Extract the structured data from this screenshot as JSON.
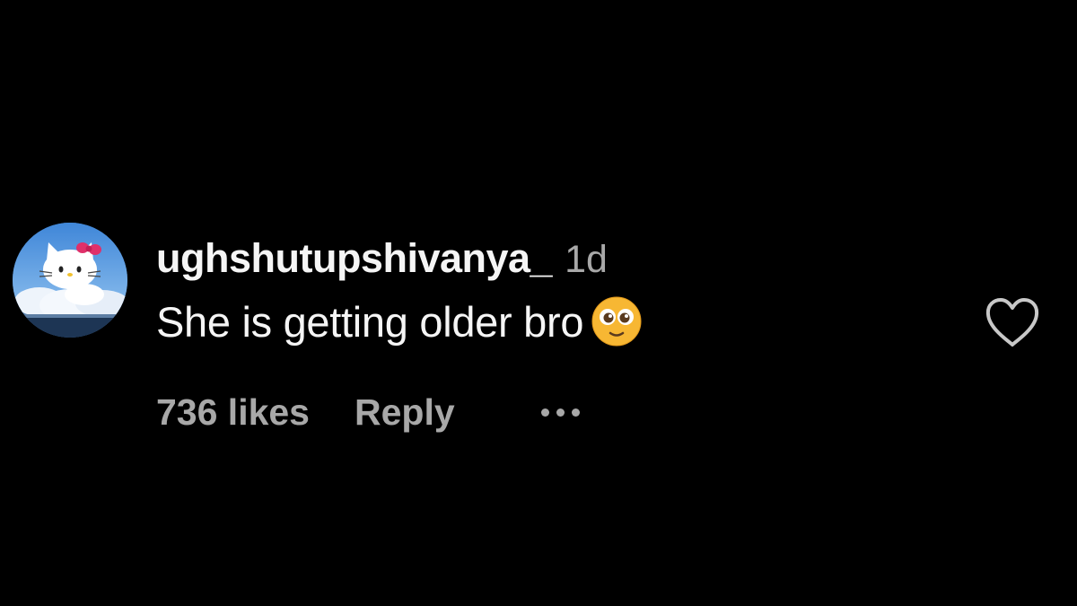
{
  "comment": {
    "username": "ughshutupshivanya_",
    "timestamp": "1d",
    "text": "She is getting older bro",
    "emoji": "pleading-face-emoji",
    "likes": "736 likes",
    "reply_label": "Reply",
    "liked": false
  },
  "colors": {
    "background": "#000000",
    "primary_text": "#f5f5f5",
    "secondary_text": "#a8a8a8",
    "emoji": "#f7b733"
  },
  "icons": {
    "like": "heart-outline-icon",
    "more": "more-options-icon",
    "avatar": "hello-kitty-avatar"
  }
}
